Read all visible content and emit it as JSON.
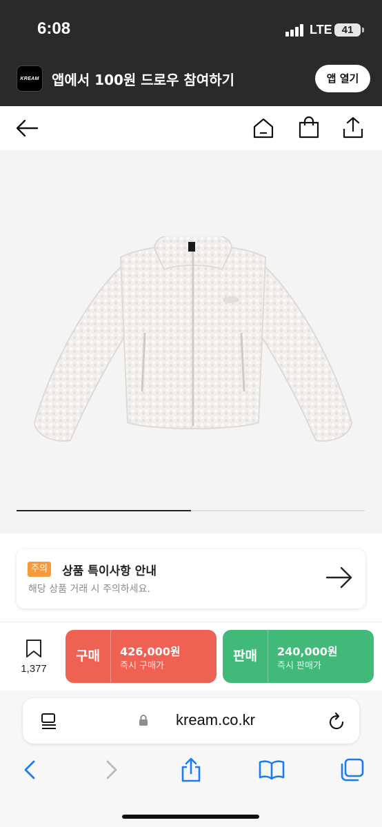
{
  "status_bar": {
    "time": "6:08",
    "network": "LTE",
    "battery": "41"
  },
  "app_banner": {
    "logo_text": "KREAM",
    "text": "앱에서 100원 드로우 참여하기",
    "open_button": "앱 열기"
  },
  "nav": {
    "icons": [
      "back-arrow-icon",
      "home-icon",
      "shopping-bag-icon",
      "share-icon"
    ]
  },
  "product": {
    "image": "white-fleece-puffer-jacket",
    "image_progress": 0.5
  },
  "notice": {
    "badge": "주의",
    "title": "상품 특이사항 안내",
    "subtitle": "해당 상품 거래 시 주의하세요."
  },
  "buy_bar": {
    "wish_count": "1,377",
    "buy": {
      "label": "구매",
      "price": "426,000원",
      "desc": "즉시 구매가",
      "color": "#ef6253"
    },
    "sell": {
      "label": "판매",
      "price": "240,000원",
      "desc": "즉시 판매가",
      "color": "#41b979"
    }
  },
  "safari": {
    "url": "kream.co.kr",
    "toolbar_icons": [
      "back-icon",
      "forward-icon",
      "share-icon",
      "bookmarks-icon",
      "tabs-icon"
    ]
  }
}
